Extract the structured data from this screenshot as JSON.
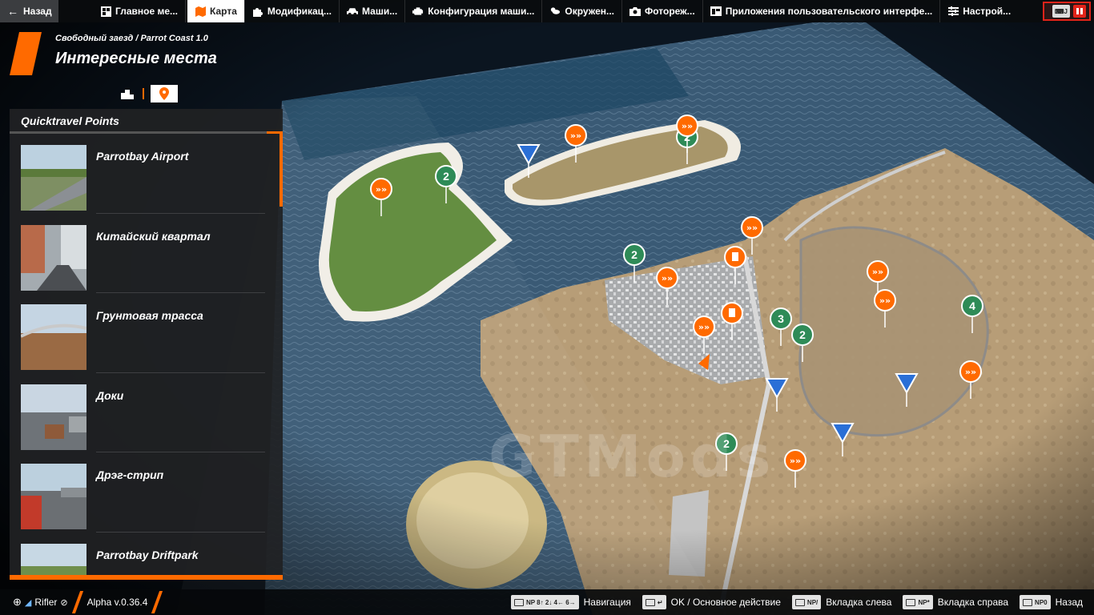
{
  "topbar": {
    "back_label": "Назад",
    "tabs": [
      {
        "label": "Главное ме...",
        "icon": "main-menu-icon",
        "active": false
      },
      {
        "label": "Карта",
        "icon": "map-icon",
        "active": true
      },
      {
        "label": "Модификац...",
        "icon": "puzzle-icon",
        "active": false
      },
      {
        "label": "Маши...",
        "icon": "car-icon",
        "active": false
      },
      {
        "label": "Конфигурация маши...",
        "icon": "engine-icon",
        "active": false
      },
      {
        "label": "Окружен...",
        "icon": "weather-icon",
        "active": false
      },
      {
        "label": "Фотореж...",
        "icon": "camera-icon",
        "active": false
      },
      {
        "label": "Приложения пользовательского интерфе...",
        "icon": "ui-apps-icon",
        "active": false
      },
      {
        "label": "Настрой...",
        "icon": "settings-sliders-icon",
        "active": false
      }
    ],
    "pause_key": "J"
  },
  "header": {
    "breadcrumb": "Свободный заезд / Parrot Coast 1.0",
    "title": "Интересные места"
  },
  "panel": {
    "heading": "Quicktravel Points",
    "items": [
      {
        "label": "Parrotbay Airport"
      },
      {
        "label": "Китайский квартал"
      },
      {
        "label": "Грунтовая трасса"
      },
      {
        "label": "Доки"
      },
      {
        "label": "Дрэг-стрип"
      },
      {
        "label": "Parrotbay Driftpark"
      }
    ]
  },
  "map": {
    "markers": [
      {
        "type": "green",
        "text": "2"
      },
      {
        "type": "green",
        "text": "2"
      },
      {
        "type": "green",
        "text": "2"
      },
      {
        "type": "green",
        "text": "3"
      },
      {
        "type": "green",
        "text": "2"
      },
      {
        "type": "green",
        "text": "4"
      },
      {
        "type": "green",
        "text": "2"
      }
    ],
    "watermark": "GTMods"
  },
  "bottombar": {
    "user": "Rifler",
    "version": "Alpha v.0.36.4",
    "hints": [
      {
        "keys": "NP 8↑ 2↓ 4← 6→",
        "label": "Навигация"
      },
      {
        "keys": "↵",
        "label": "OK / Основное действие"
      },
      {
        "keys": "NP/",
        "label": "Вкладка слева"
      },
      {
        "keys": "NP*",
        "label": "Вкладка справа"
      },
      {
        "keys": "NP0",
        "label": "Назад"
      }
    ]
  },
  "colors": {
    "accent": "#ff6a00",
    "panel": "#202123",
    "marker_green": "#2e8b57",
    "marker_orange": "#ff6a00",
    "marker_blue": "#2a6fd6"
  }
}
